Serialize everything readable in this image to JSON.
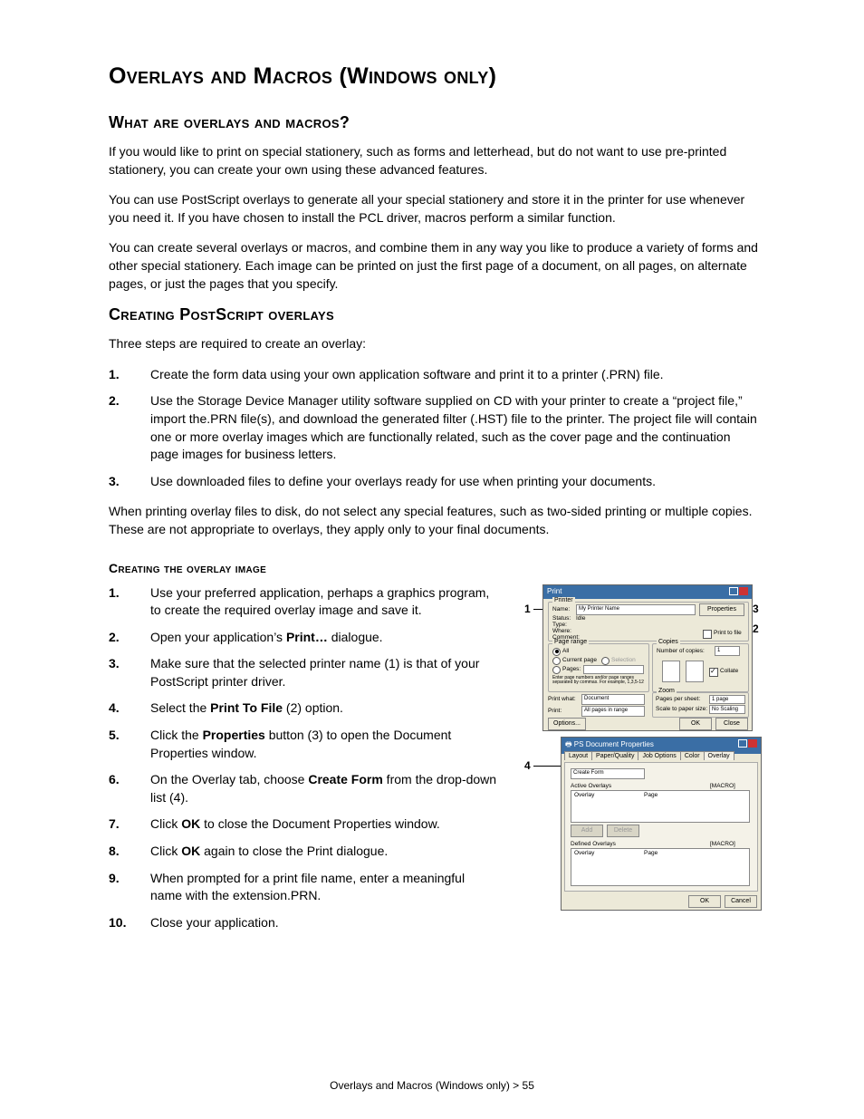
{
  "h1": "Overlays and Macros (Windows only)",
  "h2a": "What are overlays and macros?",
  "p1": "If you would like to print on special stationery, such as forms and letterhead, but do not want to use pre-printed stationery, you can create your own using these advanced features.",
  "p2": "You can use PostScript overlays to generate all your special stationery and store it in the printer for use whenever you need it. If you have chosen to install the PCL driver, macros perform a similar function.",
  "p3": "You can create several overlays or macros, and combine them in any way you like to produce a variety of forms and other special stationery. Each image can be printed on just the first page of a document, on all pages, on alternate pages, or just the pages that you specify.",
  "h2b": "Creating PostScript overlays",
  "p4": "Three steps are required to create an overlay:",
  "s1": "Create the form data using your own application software and print it to a printer (.PRN) file.",
  "s2": "Use the Storage Device Manager utility software supplied on CD with your printer to create a “project file,” import the.PRN file(s), and download the generated filter (.HST) file to the printer. The project file will contain one or more overlay images which are functionally related, such as the cover page and the continuation page images for business letters.",
  "s3": "Use downloaded files to define your overlays ready for use when printing your documents.",
  "p5": "When printing overlay files to disk, do not select any special features, such as two-sided printing or multiple copies. These are not appropriate to overlays, they apply only to your final documents.",
  "h3a": "Creating the overlay image",
  "o1": "Use your preferred application, perhaps a graphics program, to create the required overlay image and save it.",
  "o2a": "Open your application’s ",
  "o2b": "Print…",
  "o2c": " dialogue.",
  "o3": "Make sure that the selected printer name (1) is that of your PostScript printer driver.",
  "o4a": "Select the ",
  "o4b": "Print To File",
  "o4c": " (2) option.",
  "o5a": "Click the ",
  "o5b": "Properties",
  "o5c": " button (3) to open the Document Properties window.",
  "o6a": "On the Overlay tab, choose ",
  "o6b": "Create Form",
  "o6c": " from the drop-down list (4).",
  "o7a": "Click ",
  "o7b": "OK",
  "o7c": " to close the Document Properties window.",
  "o8a": "Click ",
  "o8b": "OK",
  "o8c": " again to close the Print dialogue.",
  "o9": "When prompted for a print file name, enter a meaningful name with the extension.PRN.",
  "o10": "Close your application.",
  "footer": "Overlays and Macros (Windows only) > 55",
  "dlg1": {
    "title": "Print",
    "name": "Name:",
    "nameval": "My Printer Name",
    "props": "Properties",
    "status": "Status:",
    "statusv": "Idle",
    "type": "Type:",
    "where": "Where:",
    "comment": "Comment:",
    "ptf": "Print to file",
    "pr": "Page range",
    "all": "All",
    "cur": "Current page",
    "sel": "Selection",
    "pages": "Pages:",
    "pghint": "Enter page numbers and/or page ranges separated by commas. For example, 1,3,5-12",
    "copies": "Copies",
    "nc": "Number of copies:",
    "collate": "Collate",
    "pw": "Print what:",
    "pwv": "Document",
    "pr2": "Print:",
    "pr2v": "All pages in range",
    "zoom": "Zoom",
    "pps": "Pages per sheet:",
    "ppsv": "1 page",
    "sps": "Scale to paper size:",
    "spsv": "No Scaling",
    "opt": "Options...",
    "ok": "OK",
    "close": "Close"
  },
  "dlg2": {
    "title": "PS  Document Properties",
    "tabs": [
      "Layout",
      "Paper/Quality",
      "Job Options",
      "Color",
      "Overlay"
    ],
    "dd": "Create Form",
    "ao": "Active Overlays",
    "do": "Defined Overlays",
    "col_ov": "Overlay",
    "col_pg": "Page",
    "mac": "[MACRO]",
    "add": "Add",
    "del": "Delete",
    "ok": "OK",
    "cancel": "Cancel"
  }
}
